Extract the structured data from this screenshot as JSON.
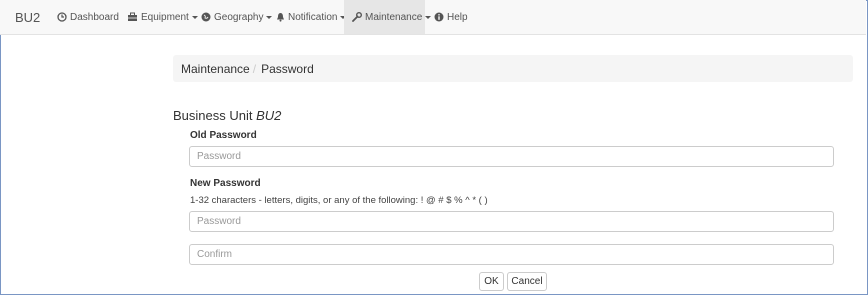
{
  "navbar": {
    "brand": "BU2",
    "items": [
      {
        "label": "Dashboard",
        "icon": "dashboard-icon",
        "dropdown": false
      },
      {
        "label": "Equipment",
        "icon": "equipment-icon",
        "dropdown": true
      },
      {
        "label": "Geography",
        "icon": "globe-icon",
        "dropdown": true
      },
      {
        "label": "Notification",
        "icon": "bell-icon",
        "dropdown": true
      },
      {
        "label": "Maintenance",
        "icon": "wrench-icon",
        "dropdown": true,
        "active": true
      },
      {
        "label": "Help",
        "icon": "info-icon",
        "dropdown": false
      }
    ]
  },
  "breadcrumb": {
    "parent": "Maintenance",
    "separator": "/",
    "current": "Password"
  },
  "form": {
    "heading_prefix": "Business Unit",
    "heading_unit": "BU2",
    "old_password_label": "Old Password",
    "old_password_placeholder": "Password",
    "new_password_label": "New Password",
    "new_password_help": "1-32 characters - letters, digits, or any of the following: ! @ # $ % ^ * ( )",
    "new_password_placeholder": "Password",
    "confirm_placeholder": "Confirm",
    "ok_label": "OK",
    "cancel_label": "Cancel"
  }
}
